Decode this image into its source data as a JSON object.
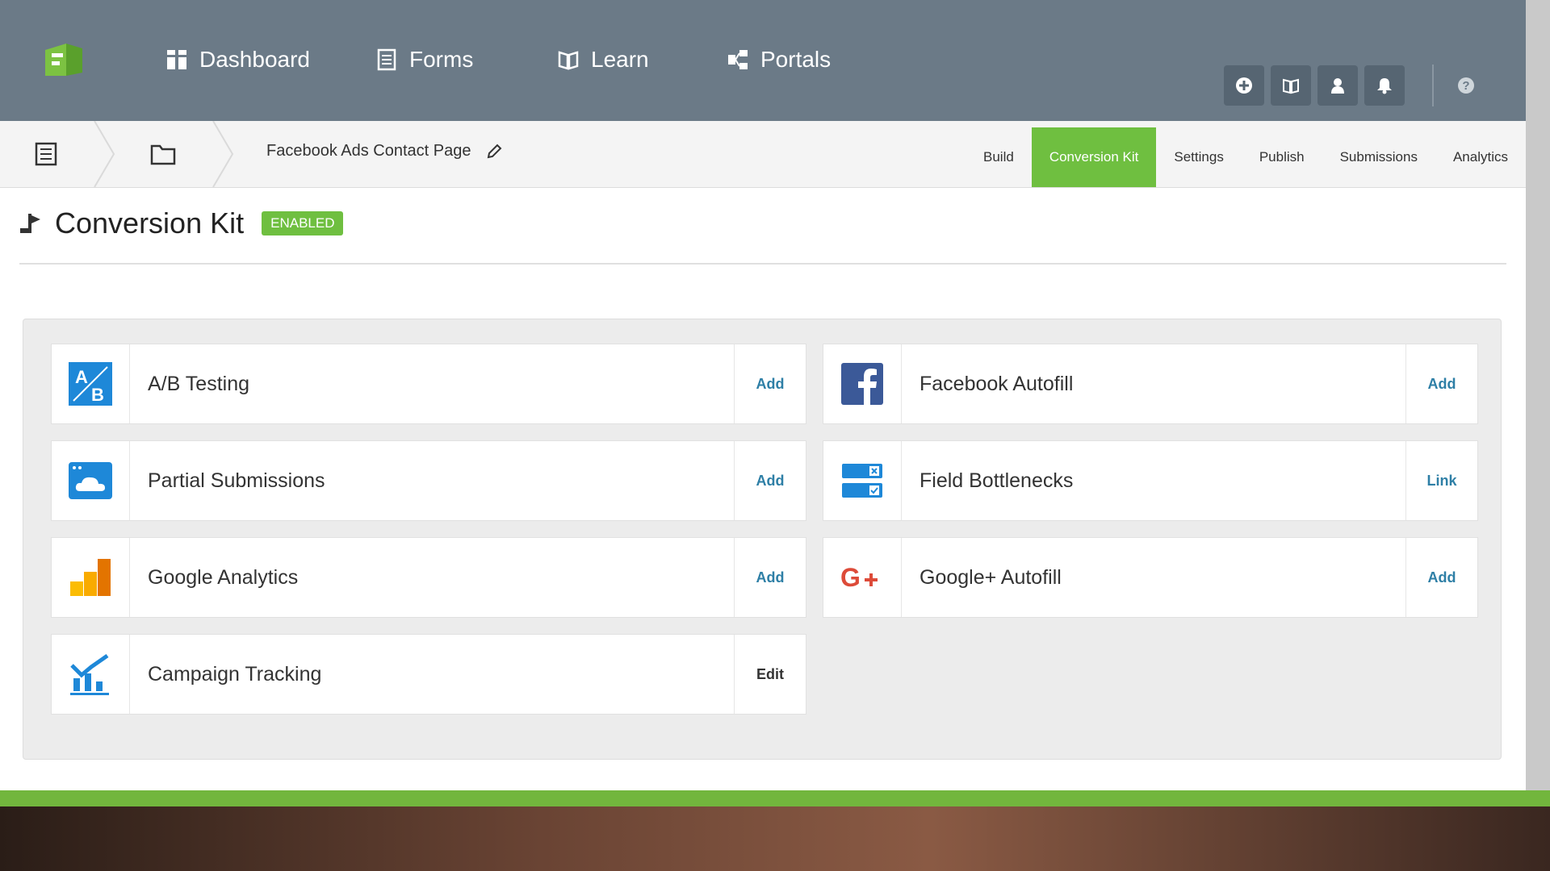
{
  "nav": {
    "items": [
      {
        "label": "Dashboard",
        "icon": "dashboard-icon"
      },
      {
        "label": "Forms",
        "icon": "forms-icon"
      },
      {
        "label": "Learn",
        "icon": "book-icon"
      },
      {
        "label": "Portals",
        "icon": "portals-icon"
      }
    ],
    "right_icons": [
      "plus-circle-icon",
      "book-icon",
      "user-icon",
      "bell-icon"
    ],
    "help_label": "?"
  },
  "subbar": {
    "form_name": "Facebook Ads Contact Page",
    "tabs": [
      {
        "label": "Build",
        "active": false
      },
      {
        "label": "Conversion Kit",
        "active": true
      },
      {
        "label": "Settings",
        "active": false
      },
      {
        "label": "Publish",
        "active": false
      },
      {
        "label": "Submissions",
        "active": false
      },
      {
        "label": "Analytics",
        "active": false
      }
    ]
  },
  "header": {
    "title": "Conversion Kit",
    "status_badge": "ENABLED"
  },
  "integrations": {
    "left": [
      {
        "label": "A/B Testing",
        "action": "Add",
        "icon": "ab-testing-icon"
      },
      {
        "label": "Partial Submissions",
        "action": "Add",
        "icon": "cloud-window-icon"
      },
      {
        "label": "Google Analytics",
        "action": "Add",
        "icon": "google-analytics-icon"
      },
      {
        "label": "Campaign Tracking",
        "action": "Edit",
        "icon": "campaign-chart-icon"
      }
    ],
    "right": [
      {
        "label": "Facebook Autofill",
        "action": "Add",
        "icon": "facebook-icon"
      },
      {
        "label": "Field Bottlenecks",
        "action": "Link",
        "icon": "field-bottlenecks-icon"
      },
      {
        "label": "Google+ Autofill",
        "action": "Add",
        "icon": "google-plus-icon"
      }
    ]
  },
  "colors": {
    "topbar": "#6b7a87",
    "accent_green": "#6fbf40",
    "link_blue": "#2e7fa6"
  }
}
